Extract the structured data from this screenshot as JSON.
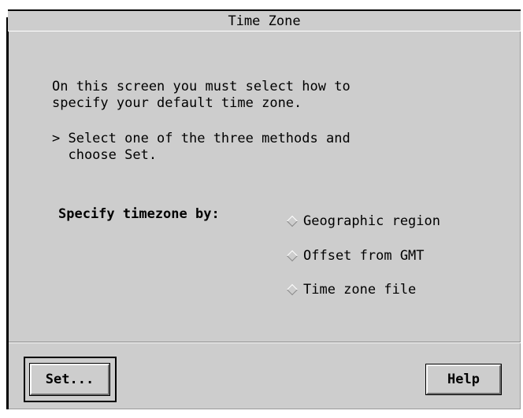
{
  "window": {
    "title": "Time Zone"
  },
  "instructions": {
    "line1": "On this screen you must select how to",
    "line2": "specify your default time zone.",
    "bullet_line1": "> Select one of the three methods and",
    "bullet_line2": "  choose Set."
  },
  "timezone_method": {
    "label": "Specify timezone by:",
    "options": [
      {
        "label": "Geographic region",
        "selected": false
      },
      {
        "label": "Offset from GMT",
        "selected": false
      },
      {
        "label": "Time zone file",
        "selected": false
      }
    ]
  },
  "buttons": {
    "set_label": "Set...",
    "help_label": "Help"
  },
  "colors": {
    "panel_background": "#cdcdcd",
    "text": "#000000",
    "highlight": "#ffffff",
    "shadow": "#6e6e6e"
  }
}
